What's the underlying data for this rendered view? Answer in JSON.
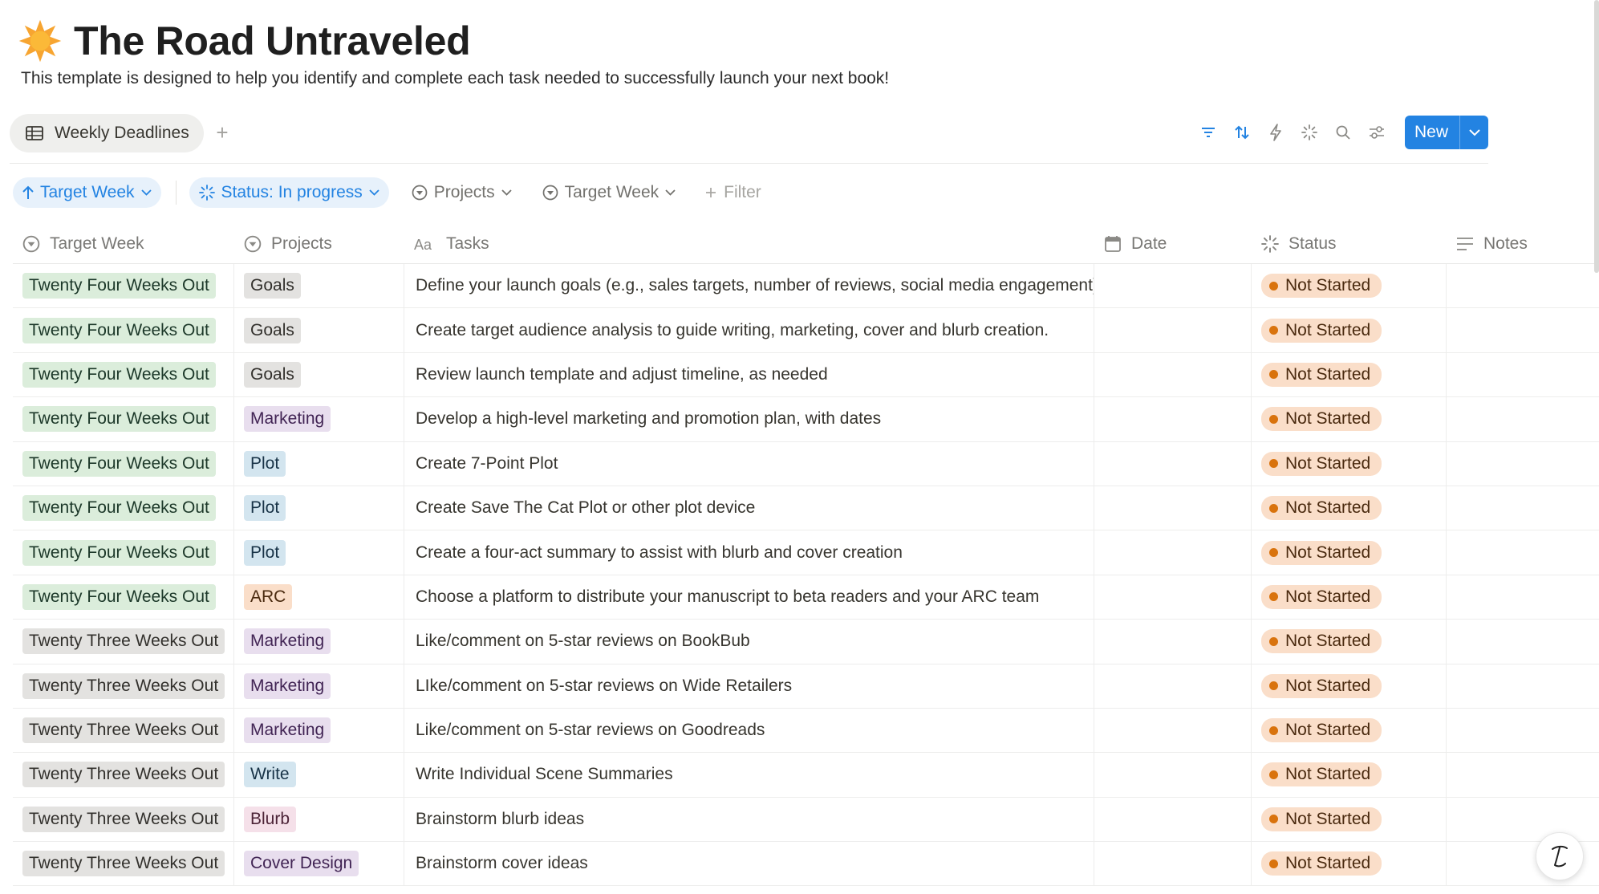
{
  "page": {
    "title": "The Road Untraveled",
    "title_icon": "sun-emoji-icon",
    "description": "This template is designed to help you identify and complete each task needed to successfully launch your next book!"
  },
  "view_tabs": {
    "active_label": "Weekly Deadlines",
    "add_label": "+"
  },
  "toolbar": {
    "icons": [
      "filter-icon",
      "sort-icon",
      "automation-icon",
      "loading-icon",
      "search-icon",
      "settings-icon"
    ],
    "new_label": "New"
  },
  "filters": {
    "sort_chip": "Target Week",
    "status_chip": "Status: In progress",
    "projects_chip": "Projects",
    "target_week_chip": "Target Week",
    "add_filter": "Filter"
  },
  "table": {
    "columns": {
      "target_week": "Target Week",
      "projects": "Projects",
      "tasks": "Tasks",
      "date": "Date",
      "status": "Status",
      "notes": "Notes"
    },
    "rows": [
      {
        "week": "Twenty Four Weeks Out",
        "project": "Goals",
        "task": "Define your launch goals (e.g., sales targets, number of reviews, social media engagement).",
        "date": "",
        "status": "Not Started",
        "notes": ""
      },
      {
        "week": "Twenty Four Weeks Out",
        "project": "Goals",
        "task": "Create target audience analysis to guide writing, marketing, cover and blurb creation.",
        "date": "",
        "status": "Not Started",
        "notes": ""
      },
      {
        "week": "Twenty Four Weeks Out",
        "project": "Goals",
        "task": "Review launch template and adjust timeline, as needed",
        "date": "",
        "status": "Not Started",
        "notes": ""
      },
      {
        "week": "Twenty Four Weeks Out",
        "project": "Marketing",
        "task": "Develop a high-level marketing and promotion plan, with dates",
        "date": "",
        "status": "Not Started",
        "notes": ""
      },
      {
        "week": "Twenty Four Weeks Out",
        "project": "Plot",
        "task": "Create 7-Point Plot",
        "date": "",
        "status": "Not Started",
        "notes": ""
      },
      {
        "week": "Twenty Four Weeks Out",
        "project": "Plot",
        "task": "Create Save The Cat Plot or other plot device",
        "date": "",
        "status": "Not Started",
        "notes": ""
      },
      {
        "week": "Twenty Four Weeks Out",
        "project": "Plot",
        "task": "Create a four-act summary to assist with blurb and cover creation",
        "date": "",
        "status": "Not Started",
        "notes": ""
      },
      {
        "week": "Twenty Four Weeks Out",
        "project": "ARC",
        "task": "Choose a platform to distribute your manuscript to beta readers and your ARC team",
        "date": "",
        "status": "Not Started",
        "notes": ""
      },
      {
        "week": "Twenty Three Weeks Out",
        "project": "Marketing",
        "task": "Like/comment on 5-star reviews on BookBub",
        "date": "",
        "status": "Not Started",
        "notes": ""
      },
      {
        "week": "Twenty Three Weeks Out",
        "project": "Marketing",
        "task": "LIke/comment on 5-star reviews on Wide Retailers",
        "date": "",
        "status": "Not Started",
        "notes": ""
      },
      {
        "week": "Twenty Three Weeks Out",
        "project": "Marketing",
        "task": "Like/comment on 5-star reviews on Goodreads",
        "date": "",
        "status": "Not Started",
        "notes": ""
      },
      {
        "week": "Twenty Three Weeks Out",
        "project": "Write",
        "task": "Write Individual Scene Summaries",
        "date": "",
        "status": "Not Started",
        "notes": ""
      },
      {
        "week": "Twenty Three Weeks Out",
        "project": "Blurb",
        "task": "Brainstorm blurb ideas",
        "date": "",
        "status": "Not Started",
        "notes": ""
      },
      {
        "week": "Twenty Three Weeks Out",
        "project": "Cover Design",
        "task": "Brainstorm cover ideas",
        "date": "",
        "status": "Not Started",
        "notes": ""
      }
    ]
  },
  "colors": {
    "accent": "#2383e2",
    "week_tags": {
      "Twenty Four Weeks Out": {
        "bg": "#dbeddb",
        "fg": "#1c3829"
      },
      "Twenty Three Weeks Out": {
        "bg": "#e3e2e0",
        "fg": "#32302c"
      }
    },
    "project_tags": {
      "Goals": {
        "bg": "#e3e2e0",
        "fg": "#32302c"
      },
      "Marketing": {
        "bg": "#e8deee",
        "fg": "#412454"
      },
      "Plot": {
        "bg": "#d3e5ef",
        "fg": "#183347"
      },
      "ARC": {
        "bg": "#fadec9",
        "fg": "#49290e"
      },
      "Write": {
        "bg": "#d3e5ef",
        "fg": "#183347"
      },
      "Blurb": {
        "bg": "#f5e0e9",
        "fg": "#4c2337"
      },
      "Cover Design": {
        "bg": "#e8deee",
        "fg": "#412454"
      }
    },
    "status": {
      "Not Started": {
        "bg": "#fadec9",
        "fg": "#49290e",
        "dot": "#d9730d"
      }
    }
  },
  "help": {
    "icon": "help-quill-icon",
    "label": "?"
  }
}
